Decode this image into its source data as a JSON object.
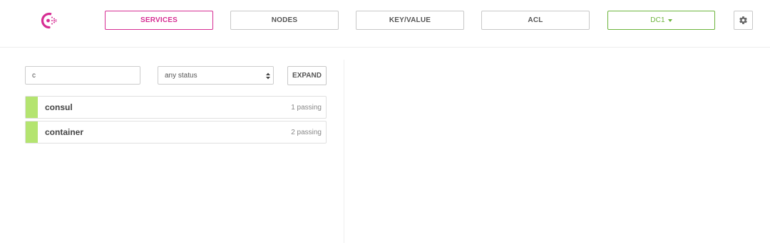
{
  "nav": {
    "logo_icon": "consul-logo-icon",
    "items": [
      {
        "label": "SERVICES",
        "active": true
      },
      {
        "label": "NODES",
        "active": false
      },
      {
        "label": "KEY/VALUE",
        "active": false
      },
      {
        "label": "ACL",
        "active": false
      }
    ],
    "datacenter": "DC1",
    "settings_icon": "gear-icon"
  },
  "filter": {
    "value": "c",
    "status_selected": "any status",
    "expand_label": "EXPAND"
  },
  "services": [
    {
      "name": "consul",
      "status": "1 passing"
    },
    {
      "name": "container",
      "status": "2 passing"
    }
  ],
  "colors": {
    "brand": "#d62d93",
    "datacenter": "#6cb43c",
    "passing": "#b4e470"
  }
}
